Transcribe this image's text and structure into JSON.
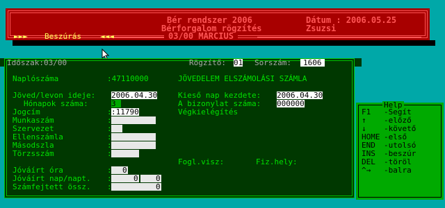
{
  "header": {
    "system_title": "Bér rendszer 2006",
    "screen_title": "Bérforgalom rögzítés",
    "period_line": "03/00 MÁRCIUS",
    "date_label": "Dátum : 2006.05.25",
    "user": "Zsuzsi"
  },
  "mode": {
    "left_arrows": "►►►",
    "label": "Beszúrás",
    "right_arrows": "◄◄◄"
  },
  "period_bar": {
    "idoszak_label": "Időszak:03/00",
    "rogzito_label": "Rögzítő:",
    "rogzito_value": "01",
    "sorszam_label": "Sorszám:",
    "sorszam_value": "1606"
  },
  "form": {
    "naploszama_label": "Naplószáma",
    "naploszama_value": ":47110000",
    "title": "JÖVEDELEM ELSZÁMOLÁSI SZÁMLA",
    "juved_label": "Jöved/levon ideje:",
    "juved_value": "2006.04.30",
    "honapok_label": "Hónapok száma:",
    "honapok_value": "3",
    "kieso_label": "Kieső nap kezdete:",
    "kieso_value": "2006.04.30",
    "bizonylat_label": "A bizonylat száma:",
    "bizonylat_value": "000000",
    "jogcim_label": "Jogcím",
    "jogcim_value": ":11790",
    "vegkielegites": "Végkielégítés",
    "munkaszam_label": "Munkaszám",
    "szervezet_label": "Szervezet",
    "ellenszamla_label": "Ellenszámla",
    "masodszla_label": "Másodszla",
    "torzsszam_label": "Törzsszám",
    "colon": ":",
    "jovairt_ora_label": "Jóváírt óra",
    "jovairt_ora_value": "0",
    "jovairt_nap_label": "Jóváírt nap/napt.",
    "jovairt_nap_value1": "0",
    "jovairt_nap_value2": "0",
    "szamfejtett_label": "Számfejtett össz.",
    "szamfejtett_value": "0",
    "fogl_visz": "Fogl.visz:",
    "fiz_hely": "Fiz.hely:"
  },
  "help": {
    "title": "Help",
    "items": [
      {
        "key": "F1",
        "desc": "-Segít"
      },
      {
        "key": "↑",
        "desc": "-előző"
      },
      {
        "key": "↓",
        "desc": "-követő"
      },
      {
        "key": "HOME",
        "desc": "-első"
      },
      {
        "key": "END",
        "desc": "-utolsó"
      },
      {
        "key": "INS",
        "desc": "-beszúr"
      },
      {
        "key": "DEL",
        "desc": "-töröl"
      },
      {
        "key": "^→",
        "desc": "-balra"
      }
    ]
  },
  "colors": {
    "background": "#00a8a8",
    "header_red": "#a80000",
    "header_text": "#ff5555",
    "panel_green": "#003800",
    "help_green": "#00aa00"
  }
}
